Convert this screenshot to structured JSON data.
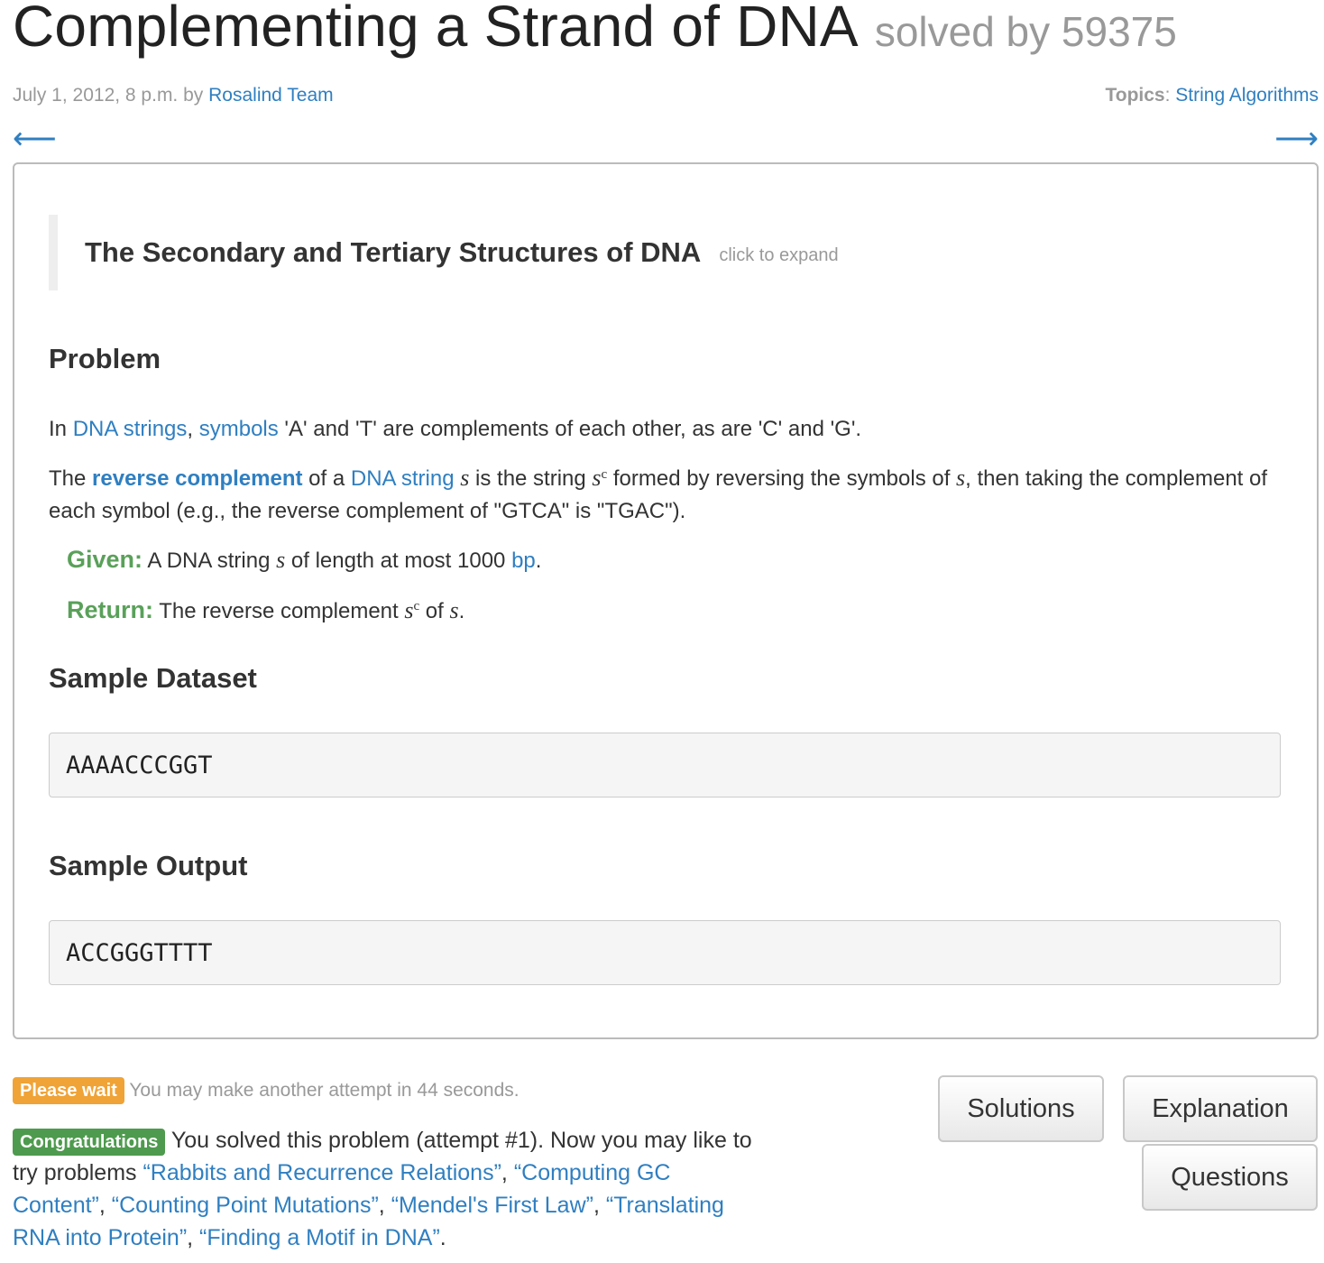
{
  "header": {
    "title": "Complementing a Strand of DNA",
    "solved_by": "solved by 59375",
    "date_prefix": "July 1, 2012, 8 p.m. by ",
    "author": "Rosalind Team",
    "topics_label": "Topics",
    "topics_colon": ": ",
    "topic": "String Algorithms",
    "prev_arrow": "⟵",
    "next_arrow": "⟶"
  },
  "story": {
    "title": "The Secondary and Tertiary Structures of DNA",
    "expand": "click to expand"
  },
  "problem": {
    "heading": "Problem",
    "p1": {
      "t1": "In ",
      "link1": "DNA strings",
      "t2": ", ",
      "link2": "symbols",
      "t3": " 'A' and 'T' are complements of each other, as are 'C' and 'G'."
    },
    "p2": {
      "t1": "The ",
      "link_reverse": "reverse complement",
      "t2": " of a ",
      "link_dna": "DNA string",
      "t3": " ",
      "var_s": "s",
      "t4": " is the string ",
      "sup_c": "c",
      "t5": " formed by reversing the symbols of ",
      "t6": ", then taking the complement of each symbol (e.g., the reverse complement of \"GTCA\" is \"TGAC\")."
    },
    "given": {
      "label": "Given:",
      "t1": " A DNA string ",
      "t2": " of length at most 1000 ",
      "link_bp": "bp",
      "t3": "."
    },
    "return": {
      "label": "Return:",
      "t1": " The reverse complement ",
      "t2": " of ",
      "t3": "."
    }
  },
  "sample_dataset": {
    "heading": "Sample Dataset",
    "value": "AAAACCCGGT"
  },
  "sample_output": {
    "heading": "Sample Output",
    "value": "ACCGGGTTTT"
  },
  "status": {
    "wait_badge": "Please wait",
    "wait_text": "You may make another attempt in 44 seconds.",
    "congrats_badge": "Congratulations",
    "congrats_text": "You solved this problem (attempt #1). Now you may like to try problems ",
    "problems": [
      "“Rabbits and Recurrence Relations”",
      "“Computing GC Content”",
      "“Counting Point Mutations”",
      "“Mendel's First Law”",
      "“Translating RNA into Protein”",
      "“Finding a Motif in DNA”"
    ],
    "sep": ", ",
    "end": "."
  },
  "buttons": {
    "solutions": "Solutions",
    "explanation": "Explanation",
    "questions": "Questions"
  },
  "colors": {
    "link": "#2f7fc1",
    "given_green": "#5aa05a",
    "wait_orange": "#f0a336",
    "congrats_green": "#4e9a4e"
  }
}
